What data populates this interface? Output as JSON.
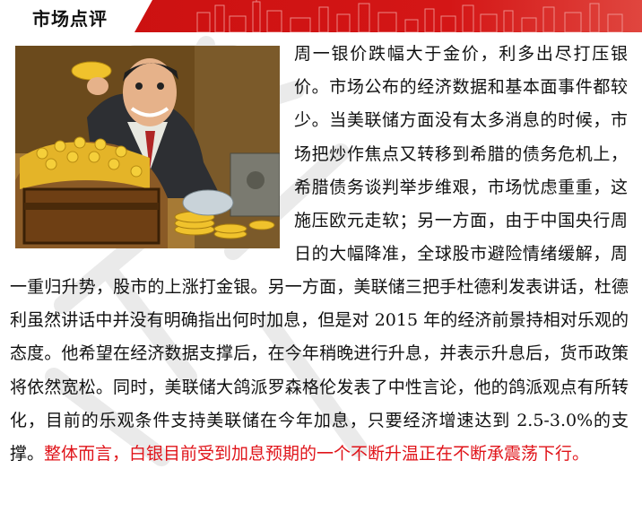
{
  "header": {
    "title": "市场点评",
    "accent_color": "#d01a1a"
  },
  "photo": {
    "icon": "cartoon-man-gold-treasure-chest-image"
  },
  "body": {
    "right_text": "周一银价跌幅大于金价，利多出尽打压银价。市场公布的经济数据和基本面事件都较少。当美联储方面没有太多消息的时候，市场把炒作焦点又转移到希腊的债务危机上，希腊债务谈判举步维艰，市场忧虑重重，这施压欧元走软；另一方面，由于中国央行周日的大幅降准，全球股市避险情绪缓解，周",
    "bottom_text": "一重归升势，股市的上涨打金银。另一方面，美联储三把手杜德利发表讲话，杜德利虽然讲话中并没有明确指出何时加息，但是对 2015 年的经济前景持相对乐观的态度。他希望在经济数据支撑后，在今年稍晚进行升息，并表示升息后，货币政策将依然宽松。同时，美联储大鸽派罗森格伦发表了中性言论，他的鸽派观点有所转化，目前的乐观条件支持美联储在今年加息，只要经济增速达到 2.5-3.0%的支撑。",
    "conclusion": "整体而言，白银目前受到加息预期的一个不断升温正在不断承震荡下行。",
    "conclusion_color": "#e0141a"
  }
}
